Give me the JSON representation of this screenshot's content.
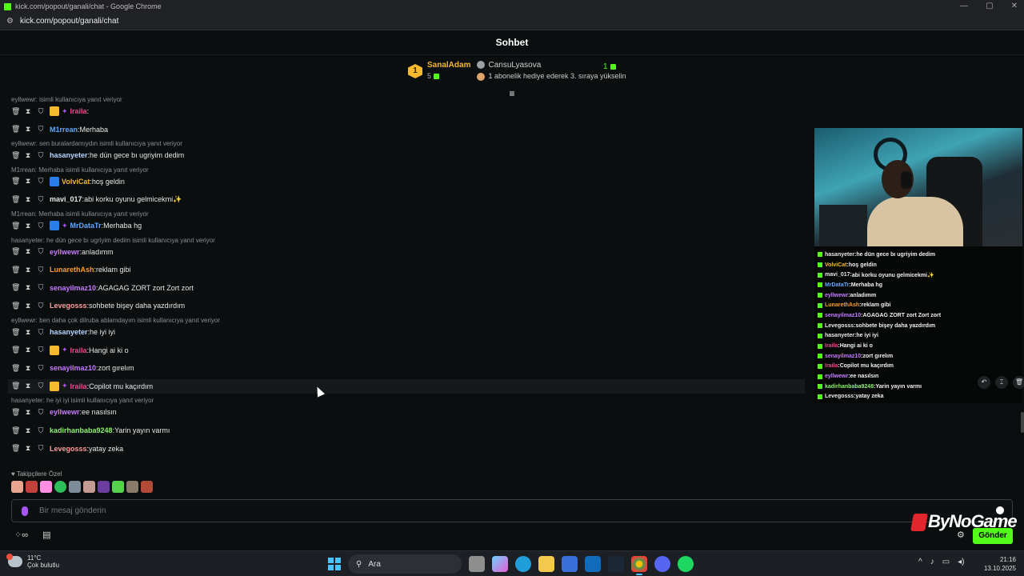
{
  "window": {
    "title": "kick.com/popout/ganali/chat - Google Chrome",
    "url": "kick.com/popout/ganali/chat"
  },
  "chat": {
    "title": "Sohbet",
    "leaderboard": {
      "first": {
        "rank": "1",
        "name": "SanalAdam",
        "count": "5"
      },
      "second": {
        "name": "CansuLyasova",
        "note": "1 abonelik hediye ederek 3. sıraya yükselin",
        "count": "1"
      }
    },
    "messages": [
      {
        "reply": "eyllwewr:  isimli kullanıcıya yanıt veriyor",
        "user": "Iraila",
        "text": "",
        "color": "#e0508f",
        "badges": [
          "crown",
          "purple"
        ]
      },
      {
        "reply": "",
        "user": "M1rrean",
        "text": "Merhaba",
        "color": "#5fa8ff",
        "badges": []
      },
      {
        "reply": "eyllwewr: sen buralardamıydın isimli kullanıcıya yanıt veriyor",
        "user": "hasanyeter",
        "text": "he dün gece bı ugriyim dedim",
        "color": "#b6d6ff",
        "badges": []
      },
      {
        "reply": "M1rrean: Merhaba isimli kullanıcıya yanıt veriyor",
        "user": "VolviCat",
        "text": "hoş geldin",
        "color": "#f5b82e",
        "badges": [
          "blue"
        ]
      },
      {
        "reply": "",
        "user": "mavi_017",
        "text": "abi korku oyunu gelmicekmi✨",
        "color": "#e8e8e8",
        "badges": []
      },
      {
        "reply": "M1rrean: Merhaba isimli kullanıcıya yanıt veriyor",
        "user": "MrDataTr",
        "text": "Merhaba hg",
        "color": "#5fa8ff",
        "badges": [
          "blue",
          "purple"
        ]
      },
      {
        "reply": "hasanyeter: he dün gece bı ugriyim dedim isimli kullanıcıya yanıt veriyor",
        "user": "eyllwewr",
        "text": "anladımm",
        "color": "#c67cff",
        "badges": []
      },
      {
        "reply": "",
        "user": "LunarethAsh",
        "text": "reklam gibi",
        "color": "#f59e2e",
        "badges": []
      },
      {
        "reply": "",
        "user": "senayilmaz10",
        "text": "AGAGAG ZORT zort Zort zort",
        "color": "#c67cff",
        "badges": []
      },
      {
        "reply": "",
        "user": "Levegosss",
        "text": "sohbete bişey daha yazdırdım",
        "color": "#ff9d9d",
        "badges": []
      },
      {
        "reply": "eyllwewr: ben daha çok dilruba ablamdayım isimli kullanıcıya yanıt veriyor",
        "user": "hasanyeter",
        "text": "he iyi iyi",
        "color": "#b6d6ff",
        "badges": []
      },
      {
        "reply": "",
        "user": "Iraila",
        "text": "Hangi ai ki o",
        "color": "#e0508f",
        "badges": [
          "crown",
          "purple"
        ]
      },
      {
        "reply": "",
        "user": "senayilmaz10",
        "text": "zort gırelım",
        "color": "#c67cff",
        "badges": []
      },
      {
        "reply": "",
        "user": "Iraila",
        "text": "Copilot mu kaçırdım",
        "color": "#e0508f",
        "badges": [
          "crown",
          "purple"
        ]
      },
      {
        "reply": "hasanyeter: he iyi iyi isimli kullanıcıya yanıt veriyor",
        "user": "eyllwewr",
        "text": "ee nasılsın",
        "color": "#c67cff",
        "badges": []
      },
      {
        "reply": "",
        "user": "kadirhanbaba9248",
        "text": "Yarin yayın varmı",
        "color": "#8cf26b",
        "badges": []
      },
      {
        "reply": "",
        "user": "Levegosss",
        "text": "yatay zeka",
        "color": "#ff9d9d",
        "badges": []
      }
    ],
    "followers_label": "Takipçilere Özel",
    "input_placeholder": "Bir mesaj gönderin",
    "send_label": "Gönder"
  },
  "pip_chat": [
    {
      "user": "hasanyeter",
      "text": "he dün gece bı ugriyim dedim",
      "color": "#e8e8e8"
    },
    {
      "user": "VolviCat",
      "text": "hoş geldin",
      "color": "#f5b82e"
    },
    {
      "user": "mavi_017",
      "text": "abi korku oyunu gelmicekmi✨",
      "color": "#e8e8e8"
    },
    {
      "user": "MrDataTr",
      "text": "Merhaba hg",
      "color": "#5fa8ff"
    },
    {
      "user": "eyllwewr",
      "text": "anladımm",
      "color": "#c67cff"
    },
    {
      "user": "LunarethAsh",
      "text": "reklam gibi",
      "color": "#f59e2e"
    },
    {
      "user": "senayilmaz10",
      "text": "AGAGAG ZORT zort Zort zort",
      "color": "#c67cff"
    },
    {
      "user": "Levegosss",
      "text": "sohbete bişey daha yazdırdım",
      "color": "#e8e8e8"
    },
    {
      "user": "hasanyeter",
      "text": "he iyi iyi",
      "color": "#e8e8e8"
    },
    {
      "user": "Iraila",
      "text": "Hangi ai ki o",
      "color": "#e0508f"
    },
    {
      "user": "senayilmaz10",
      "text": "zort gırelım",
      "color": "#c67cff"
    },
    {
      "user": "Iraila",
      "text": "Copilot mu kaçırdım",
      "color": "#e0508f"
    },
    {
      "user": "eyllwewr",
      "text": "ee nasılsın",
      "color": "#c67cff"
    },
    {
      "user": "kadirhanbaba9248",
      "text": "Yarin yayın varmı",
      "color": "#8cf26b"
    },
    {
      "user": "Levegosss",
      "text": "yatay zeka",
      "color": "#e8e8e8"
    }
  ],
  "watermark": "ByNoGame",
  "taskbar": {
    "weather_temp": "11°C",
    "weather_desc": "Çok bulutlu",
    "search_label": "Ara",
    "time": "21:16",
    "date": "13.10.2025"
  },
  "colors": {
    "accent": "#53fc18",
    "background": "#0b0e0f"
  }
}
